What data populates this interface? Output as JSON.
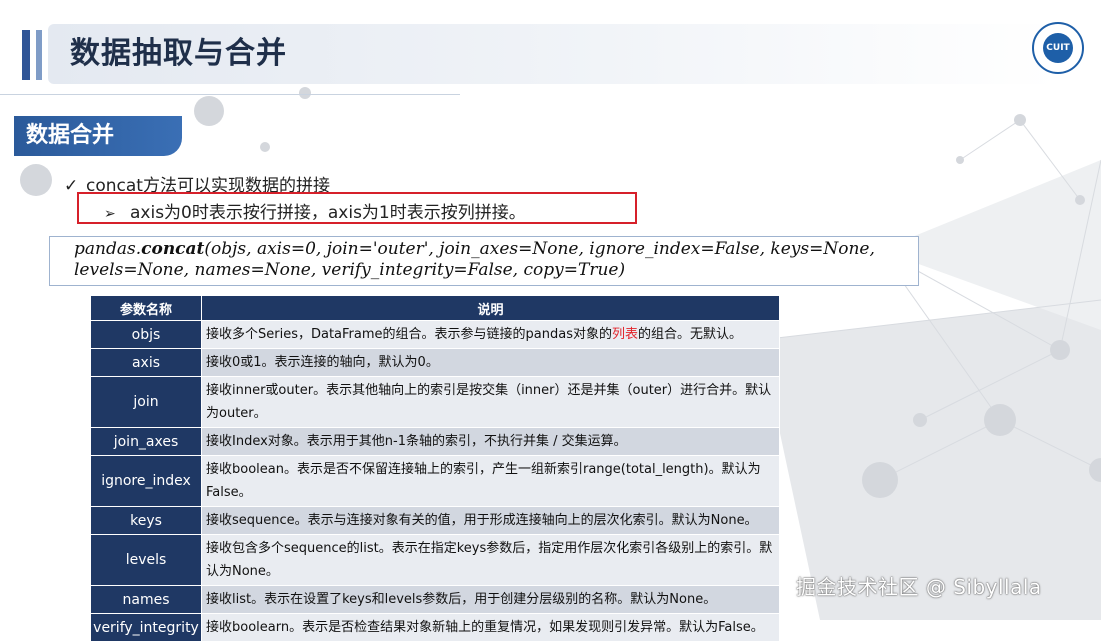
{
  "slide": {
    "title": "数据抽取与合并",
    "section_tag": "数据合并",
    "logo_text": "CUIT"
  },
  "bullets": {
    "check_mark": "✓",
    "arrow_mark": "➢",
    "level1": "concat方法可以实现数据的拼接",
    "level2": "axis为0时表示按行拼接，axis为1时表示按列拼接。"
  },
  "signature": {
    "prefix": "pandas.",
    "func": "concat",
    "args_line1": "(objs, axis=0, join='outer', join_axes=None, ignore_index=False, keys=None,",
    "args_line2": "levels=None, names=None, verify_integrity=False, copy=True)"
  },
  "table": {
    "headers": [
      "参数名称",
      "说明"
    ],
    "rows": [
      {
        "name": "objs",
        "desc_before": "接收多个Series，DataFrame的组合。表示参与链接的pandas对象的",
        "desc_highlight": "列表",
        "desc_after": "的组合。无默认。"
      },
      {
        "name": "axis",
        "desc_before": "接收0或1。表示连接的轴向，默认为0。",
        "desc_highlight": "",
        "desc_after": ""
      },
      {
        "name": "join",
        "desc_before": "接收inner或outer。表示其他轴向上的索引是按交集（inner）还是并集（outer）进行合并。默认为outer。",
        "desc_highlight": "",
        "desc_after": ""
      },
      {
        "name": "join_axes",
        "desc_before": "接收Index对象。表示用于其他n-1条轴的索引，不执行并集 / 交集运算。",
        "desc_highlight": "",
        "desc_after": ""
      },
      {
        "name": "ignore_index",
        "desc_before": "接收boolean。表示是否不保留连接轴上的索引，产生一组新索引range(total_length)。默认为False。",
        "desc_highlight": "",
        "desc_after": ""
      },
      {
        "name": "keys",
        "desc_before": "接收sequence。表示与连接对象有关的值，用于形成连接轴向上的层次化索引。默认为None。",
        "desc_highlight": "",
        "desc_after": ""
      },
      {
        "name": "levels",
        "desc_before": "接收包含多个sequence的list。表示在指定keys参数后，指定用作层次化索引各级别上的索引。默认为None。",
        "desc_highlight": "",
        "desc_after": ""
      },
      {
        "name": "names",
        "desc_before": "接收list。表示在设置了keys和levels参数后，用于创建分层级别的名称。默认为None。",
        "desc_highlight": "",
        "desc_after": ""
      },
      {
        "name": "verify_integrity",
        "desc_before": "接收boolearn。表示是否检查结果对象新轴上的重复情况，如果发现则引发异常。默认为False。",
        "desc_highlight": "",
        "desc_after": ""
      }
    ]
  },
  "watermark": "掘金技术社区 @ Sibyllala",
  "colors": {
    "header_navy": "#1f3864",
    "highlight_red": "#e3242b",
    "box_red": "#d6202a",
    "tag_blue": "#2b5a9a"
  }
}
